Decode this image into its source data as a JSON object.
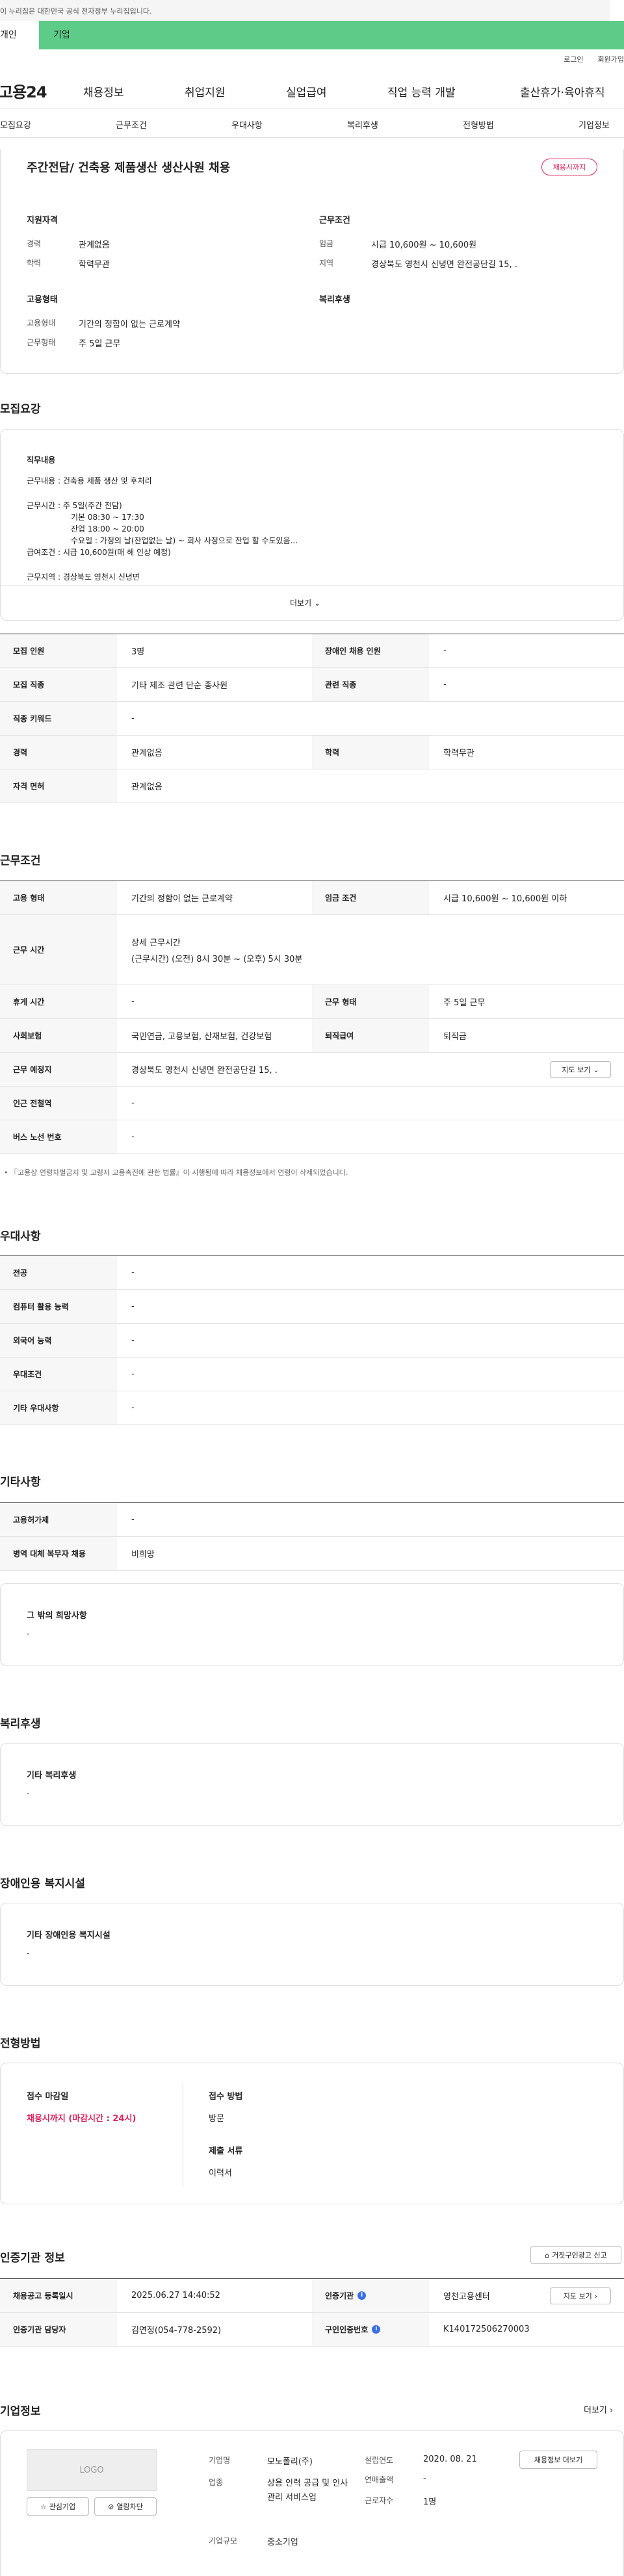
{
  "gov_bar": "이 누리집은 대한민국 공식 전자정부 누리집입니다.",
  "tabs": {
    "personal": "개인",
    "company": "기업"
  },
  "util": {
    "login": "로그인",
    "join": "회원가입"
  },
  "logo": "고용24",
  "gnb": [
    "채용정보",
    "취업지원",
    "실업급여",
    "직업 능력 개발",
    "출산휴가·육아휴직"
  ],
  "lnb": [
    "모집요강",
    "근무조건",
    "우대사항",
    "복리후생",
    "전형방법",
    "기업정보"
  ],
  "summary": {
    "title": "주간전담/ 건축용 제품생산 생산사원 채용",
    "badge": "채용시까지",
    "qual_title": "지원자격",
    "career_l": "경력",
    "career_v": "관계없음",
    "edu_l": "학력",
    "edu_v": "학력무관",
    "cond_title": "근무조건",
    "wage_l": "임금",
    "wage_v": "시급 10,600원 ~ 10,600원",
    "area_l": "지역",
    "area_v": "경상북도 영천시 신녕면 완전공단길 15, .",
    "emp_title": "고용형태",
    "emp_l1": "고용형태",
    "emp_v1": "기간의 정함이 없는 근로계약",
    "emp_l2": "근무형태",
    "emp_v2": "주 5일 근무",
    "welfare_title": "복리후생"
  },
  "recruit": {
    "title": "모집요강",
    "job_title": "직무내용",
    "lines": [
      "근무내용 : 건축용 제품 생산 및 후처리",
      "근무시간 : 주 5일(주간 전담)",
      "기본 08:30 ~ 17:30",
      "잔업 18:00 ~ 20:00",
      "수요일 : 가정의 날(잔업없는 날) ~ 회사 사정으로 잔업 할 수도있음...",
      "급여조건 : 시급 10,600원(매 해 인상 예정)",
      "근무지역 : 경상북도 영천시 신녕면"
    ],
    "more": "더보기",
    "table": [
      {
        "th": "모집 인원",
        "td": "3명",
        "th2": "장애인 채용 인원",
        "td2": "-"
      },
      {
        "th": "모집 직종",
        "td": "기타 제조 관련 단순 종사원",
        "th2": "관련 직종",
        "td2": "-"
      },
      {
        "th": "직종 키워드",
        "td": "-"
      },
      {
        "th": "경력",
        "td": "관계없음",
        "th2": "학력",
        "td2": "학력무관"
      },
      {
        "th": "자격 면허",
        "td": "관계없음"
      }
    ]
  },
  "work": {
    "title": "근무조건",
    "r1": {
      "th": "고용 형태",
      "td": "기간의 정함이 없는 근로계약",
      "th2": "임금 조건",
      "td2": "시급 10,600원 ~ 10,600원 이하"
    },
    "r2": {
      "th": "근무 시간",
      "td_a": "상세 근무시간",
      "td_b": "(근무시간) (오전) 8시 30분 ~ (오후) 5시 30분"
    },
    "r3": {
      "th": "휴게 시간",
      "td": "-",
      "th2": "근무 형태",
      "td2": "주 5일 근무"
    },
    "r4": {
      "th": "사회보험",
      "td": "국민연금, 고용보험, 산재보험, 건강보험",
      "th2": "퇴직급여",
      "td2": "퇴직금"
    },
    "r5": {
      "th": "근무 예정지",
      "td": "경상북도 영천시 신녕면 완전공단길 15, .",
      "btn": "지도 보기"
    },
    "r6": {
      "th": "인근 전철역",
      "td": "-"
    },
    "r7": {
      "th": "버스 노선 번호",
      "td": "-"
    },
    "note": "『고용상 연령차별금지 및 고령자 고용촉진에 관한 법률』이 시행됨에 따라 채용정보에서 연령이 삭제되었습니다."
  },
  "pref": {
    "title": "우대사항",
    "rows": [
      {
        "th": "전공",
        "td": "-"
      },
      {
        "th": "컴퓨터 활용 능력",
        "td": "-"
      },
      {
        "th": "외국어 능력",
        "td": "-"
      },
      {
        "th": "우대조건",
        "td": "-"
      },
      {
        "th": "기타 우대사항",
        "td": "-"
      }
    ]
  },
  "etc": {
    "title": "기타사항",
    "rows": [
      {
        "th": "고용허가제",
        "td": "-"
      },
      {
        "th": "병역 대체 복무자 채용",
        "td": "비희망"
      }
    ],
    "wish_title": "그 밖의 희망사항",
    "wish_v": "-"
  },
  "welfare": {
    "title": "복리후생",
    "sub": "기타 복리후생",
    "v": "-"
  },
  "disabled": {
    "title": "장애인용 복지시설",
    "sub": "기타 장애인용 복지시설",
    "v": "-"
  },
  "process": {
    "title": "전형방법",
    "deadline_l": "접수 마감일",
    "deadline_v": "채용시까지 (마감시간 : 24시)",
    "method_l": "접수 방법",
    "method_v": "방문",
    "docs_l": "제출 서류",
    "docs_v": "이력서"
  },
  "agency": {
    "title": "인증기관 정보",
    "report_btn": "거짓구인광고 신고",
    "r1": {
      "th": "채용공고 등록일시",
      "td": "2025.06.27 14:40:52",
      "th2": "인증기관",
      "td2": "영천고용센터",
      "btn": "지도 보기"
    },
    "r2": {
      "th": "인증기관 담당자",
      "td": "김연정(054-778-2592)",
      "th2": "구인인증번호",
      "td2": "K140172506270003"
    }
  },
  "company": {
    "title": "기업정보",
    "more": "더보기",
    "logo": "LOGO",
    "interest": "관심기업",
    "block": "열람차단",
    "name_l": "기업명",
    "name_v": "모노폴리(주)",
    "ind_l": "업종",
    "ind_v": "상용 인력 공급 및 인사관리 서비스업",
    "size_l": "기업규모",
    "size_v": "중소기업",
    "year_l": "설립연도",
    "year_v": "2020. 08. 21",
    "sales_l": "연매출액",
    "sales_v": "-",
    "emp_l": "근로자수",
    "emp_v": "1명",
    "jobs_btn": "채용정보 더보기"
  }
}
